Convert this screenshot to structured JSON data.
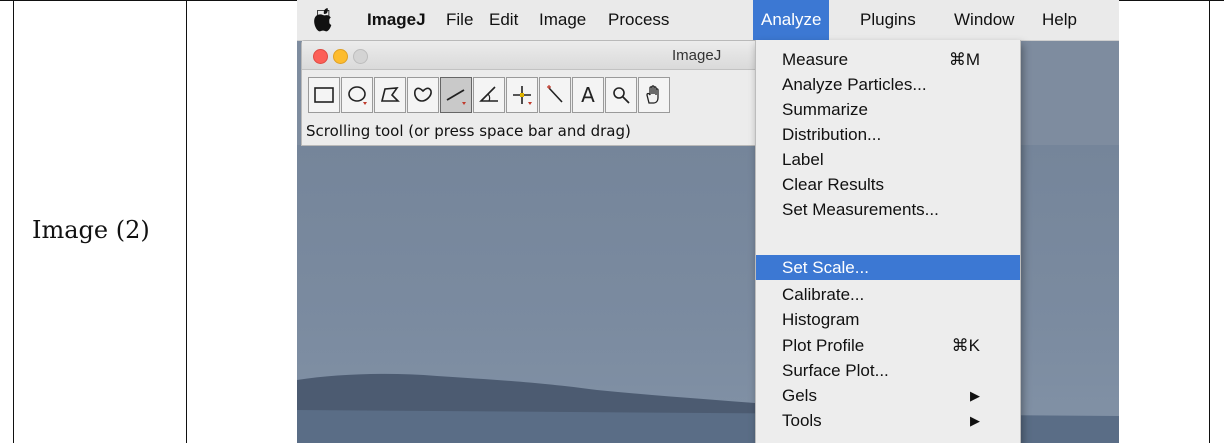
{
  "table": {
    "row_label": "Image (2)"
  },
  "menubar": {
    "apple_icon": "apple-logo",
    "app_name": "ImageJ",
    "items": [
      "File",
      "Edit",
      "Image",
      "Process",
      "Analyze",
      "Plugins",
      "Window",
      "Help"
    ],
    "active": "Analyze",
    "active_color": "#3c78d3"
  },
  "window": {
    "title": "ImageJ",
    "status_text": "Scrolling tool (or press space bar and drag)",
    "more_tools": "≫",
    "tools": [
      "rectangle-tool",
      "oval-tool",
      "polygon-tool",
      "freehand-tool",
      "line-tool",
      "angle-tool",
      "point-tool",
      "wand-tool",
      "text-tool",
      "magnifier-tool",
      "scrolling-tool"
    ],
    "text_tool_label": "A"
  },
  "analyze_menu": {
    "items": [
      {
        "label": "Measure",
        "shortcut": "⌘M"
      },
      {
        "label": "Analyze Particles...",
        "shortcut": ""
      },
      {
        "label": "Summarize",
        "shortcut": ""
      },
      {
        "label": "Distribution...",
        "shortcut": ""
      },
      {
        "label": "Label",
        "shortcut": ""
      },
      {
        "label": "Clear Results",
        "shortcut": ""
      },
      {
        "label": "Set Measurements...",
        "shortcut": ""
      },
      {
        "label": "Set Scale...",
        "shortcut": "",
        "highlighted": true
      },
      {
        "label": "Calibrate...",
        "shortcut": ""
      },
      {
        "label": "Histogram",
        "shortcut": ""
      },
      {
        "label": "Plot Profile",
        "shortcut": "⌘K"
      },
      {
        "label": "Surface Plot...",
        "shortcut": ""
      },
      {
        "label": "Gels",
        "shortcut": "",
        "submenu": "▶"
      },
      {
        "label": "Tools",
        "shortcut": "",
        "submenu": "▶"
      }
    ]
  }
}
